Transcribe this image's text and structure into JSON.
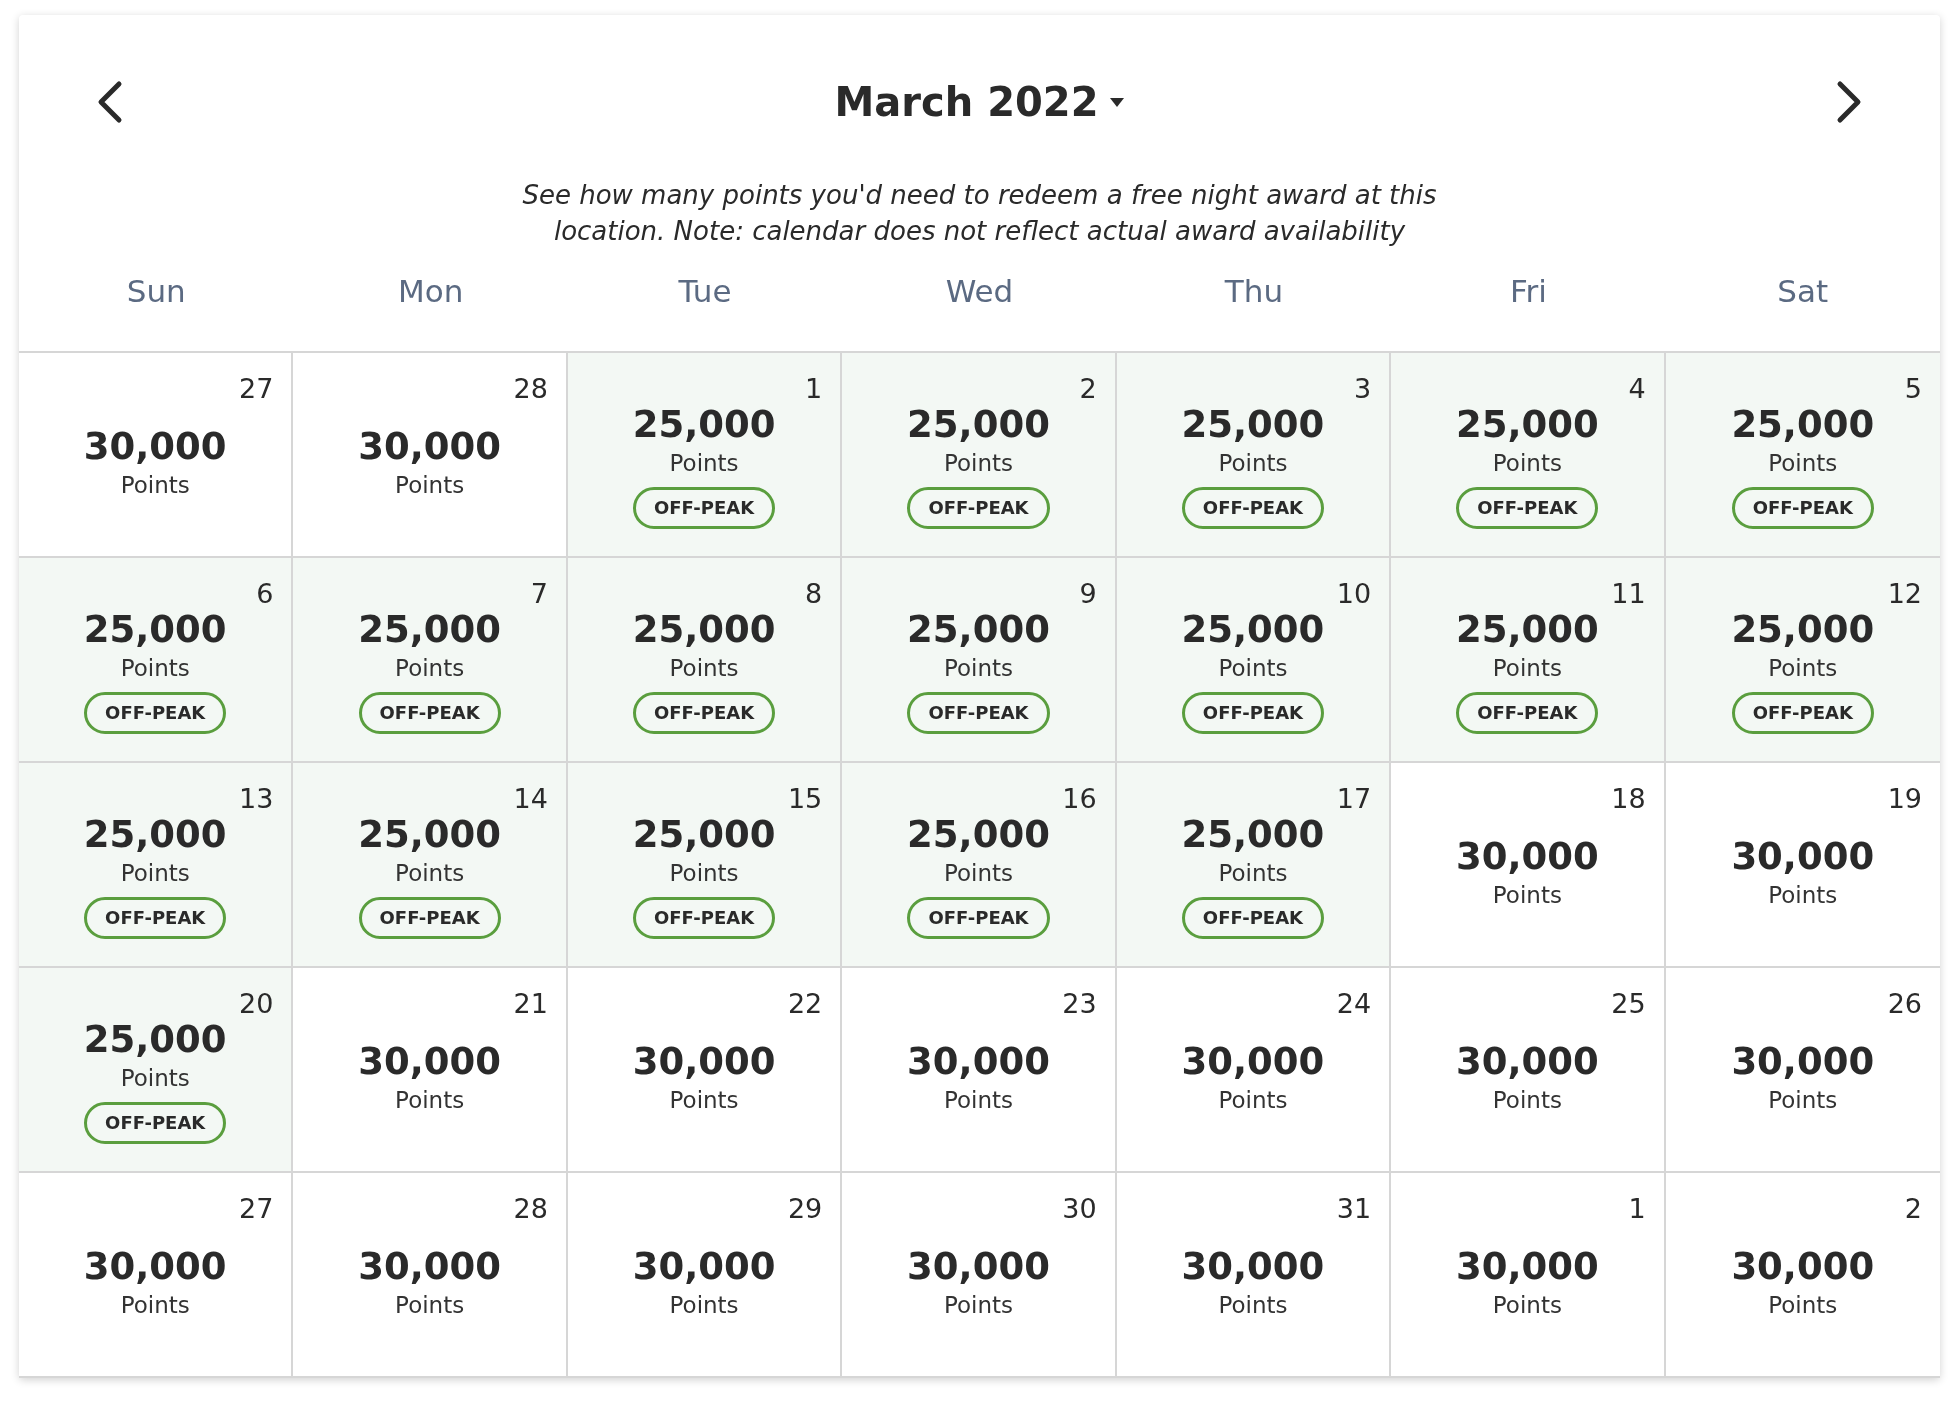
{
  "header": {
    "title": "March 2022",
    "note": "See how many points you'd need to redeem a free night award at this location. Note: calendar does not reflect actual award availability"
  },
  "weekdays": [
    "Sun",
    "Mon",
    "Tue",
    "Wed",
    "Thu",
    "Fri",
    "Sat"
  ],
  "days": [
    {
      "day": "27",
      "points": "30,000",
      "unit": "Points"
    },
    {
      "day": "28",
      "points": "30,000",
      "unit": "Points"
    },
    {
      "day": "1",
      "points": "25,000",
      "unit": "Points",
      "badge": "OFF-PEAK"
    },
    {
      "day": "2",
      "points": "25,000",
      "unit": "Points",
      "badge": "OFF-PEAK"
    },
    {
      "day": "3",
      "points": "25,000",
      "unit": "Points",
      "badge": "OFF-PEAK"
    },
    {
      "day": "4",
      "points": "25,000",
      "unit": "Points",
      "badge": "OFF-PEAK"
    },
    {
      "day": "5",
      "points": "25,000",
      "unit": "Points",
      "badge": "OFF-PEAK"
    },
    {
      "day": "6",
      "points": "25,000",
      "unit": "Points",
      "badge": "OFF-PEAK"
    },
    {
      "day": "7",
      "points": "25,000",
      "unit": "Points",
      "badge": "OFF-PEAK"
    },
    {
      "day": "8",
      "points": "25,000",
      "unit": "Points",
      "badge": "OFF-PEAK"
    },
    {
      "day": "9",
      "points": "25,000",
      "unit": "Points",
      "badge": "OFF-PEAK"
    },
    {
      "day": "10",
      "points": "25,000",
      "unit": "Points",
      "badge": "OFF-PEAK"
    },
    {
      "day": "11",
      "points": "25,000",
      "unit": "Points",
      "badge": "OFF-PEAK"
    },
    {
      "day": "12",
      "points": "25,000",
      "unit": "Points",
      "badge": "OFF-PEAK"
    },
    {
      "day": "13",
      "points": "25,000",
      "unit": "Points",
      "badge": "OFF-PEAK"
    },
    {
      "day": "14",
      "points": "25,000",
      "unit": "Points",
      "badge": "OFF-PEAK"
    },
    {
      "day": "15",
      "points": "25,000",
      "unit": "Points",
      "badge": "OFF-PEAK"
    },
    {
      "day": "16",
      "points": "25,000",
      "unit": "Points",
      "badge": "OFF-PEAK"
    },
    {
      "day": "17",
      "points": "25,000",
      "unit": "Points",
      "badge": "OFF-PEAK"
    },
    {
      "day": "18",
      "points": "30,000",
      "unit": "Points"
    },
    {
      "day": "19",
      "points": "30,000",
      "unit": "Points"
    },
    {
      "day": "20",
      "points": "25,000",
      "unit": "Points",
      "badge": "OFF-PEAK"
    },
    {
      "day": "21",
      "points": "30,000",
      "unit": "Points"
    },
    {
      "day": "22",
      "points": "30,000",
      "unit": "Points"
    },
    {
      "day": "23",
      "points": "30,000",
      "unit": "Points"
    },
    {
      "day": "24",
      "points": "30,000",
      "unit": "Points"
    },
    {
      "day": "25",
      "points": "30,000",
      "unit": "Points"
    },
    {
      "day": "26",
      "points": "30,000",
      "unit": "Points"
    },
    {
      "day": "27",
      "points": "30,000",
      "unit": "Points"
    },
    {
      "day": "28",
      "points": "30,000",
      "unit": "Points"
    },
    {
      "day": "29",
      "points": "30,000",
      "unit": "Points"
    },
    {
      "day": "30",
      "points": "30,000",
      "unit": "Points"
    },
    {
      "day": "31",
      "points": "30,000",
      "unit": "Points"
    },
    {
      "day": "1",
      "points": "30,000",
      "unit": "Points"
    },
    {
      "day": "2",
      "points": "30,000",
      "unit": "Points"
    }
  ]
}
